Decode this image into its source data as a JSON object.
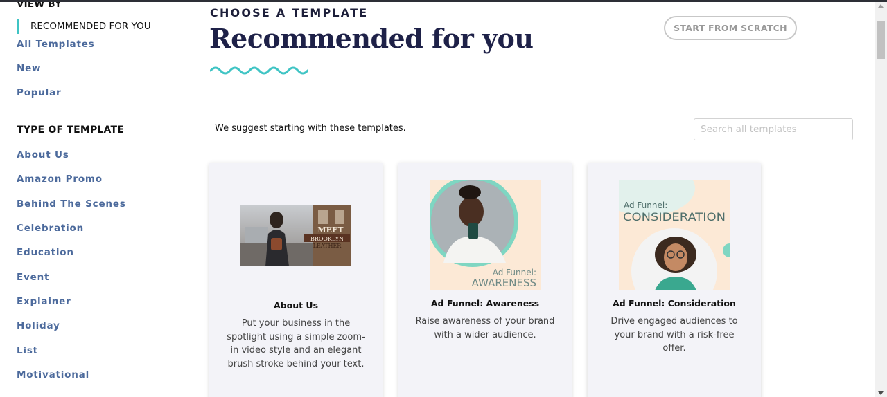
{
  "sidebar": {
    "view_by_heading": "VIEW BY",
    "active_item": "RECOMMENDED FOR YOU",
    "view_links": [
      "All Templates",
      "New",
      "Popular"
    ],
    "type_heading": "TYPE OF TEMPLATE",
    "type_links": [
      "About Us",
      "Amazon Promo",
      "Behind The Scenes",
      "Celebration",
      "Education",
      "Event",
      "Explainer",
      "Holiday",
      "List",
      "Motivational"
    ]
  },
  "header": {
    "eyebrow": "CHOOSE A TEMPLATE",
    "title": "Recommended for you",
    "start_from_scratch": "START FROM SCRATCH"
  },
  "main": {
    "suggest_text": "We suggest starting with these templates.",
    "search_placeholder": "Search all templates"
  },
  "cards": [
    {
      "title": "About Us",
      "description": "Put your business in the spotlight using a simple zoom-in video style and an elegant brush stroke behind your text.",
      "thumb_text": [
        "MEET",
        "BROOKLYN",
        "LEATHER"
      ]
    },
    {
      "title": "Ad Funnel: Awareness",
      "description": "Raise awareness of your brand with a wider audience.",
      "thumb_text": [
        "Ad Funnel:",
        "AWARENESS"
      ]
    },
    {
      "title": "Ad Funnel: Consideration",
      "description": "Drive engaged audiences to your brand with a risk-free offer.",
      "thumb_text": [
        "Ad Funnel:",
        "CONSIDERATION"
      ]
    }
  ],
  "colors": {
    "accent_teal": "#3fc4c4",
    "link_blue": "#4c6a9c",
    "title_navy": "#1e2148",
    "card_bg": "#f3f3f8"
  }
}
